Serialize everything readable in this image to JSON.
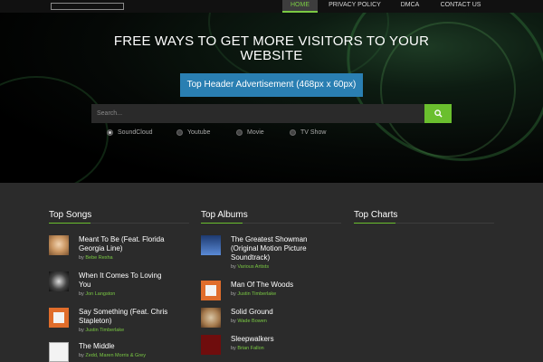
{
  "nav": {
    "items": [
      {
        "label": "HOME",
        "active": true
      },
      {
        "label": "PRIVACY POLICY",
        "active": false
      },
      {
        "label": "DMCA",
        "active": false
      },
      {
        "label": "CONTACT US",
        "active": false
      }
    ]
  },
  "hero": {
    "title_line1": "FREE WAYS TO GET MORE VISITORS TO YOUR",
    "title_line2": "WEBSITE",
    "ad_label": "Top Header Advertisement (468px x 60px)"
  },
  "search": {
    "placeholder": "Search...",
    "button_icon": "search-icon",
    "options": [
      {
        "label": "SoundCloud",
        "selected": true
      },
      {
        "label": "Youtube",
        "selected": false
      },
      {
        "label": "Movie",
        "selected": false
      },
      {
        "label": "TV Show",
        "selected": false
      }
    ]
  },
  "colors": {
    "accent": "#6abf2e",
    "ad": "#2a7fb2",
    "background": "#2b2b2b"
  },
  "top_songs": {
    "title": "Top Songs",
    "by": "by",
    "items": [
      {
        "line1": "Meant To Be (Feat. Florida",
        "line2": "Georgia Line)",
        "artist": "Bebe Rexha"
      },
      {
        "line1": "When It Comes To Loving",
        "line2": "You",
        "artist": "Jon Langston"
      },
      {
        "line1": "Say Something (Feat. Chris",
        "line2": "Stapleton)",
        "artist": "Justin Timberlake"
      },
      {
        "line1": "The Middle",
        "line2": "",
        "artist": "Zedd, Maren Morris & Grey"
      }
    ]
  },
  "top_albums": {
    "title": "Top Albums",
    "items": [
      {
        "line1": "The Greatest Showman",
        "line2": "(Original Motion Picture",
        "line3": "Soundtrack)",
        "artist": "Various Artists"
      },
      {
        "line1": "Man Of The Woods",
        "artist": "Justin Timberlake"
      },
      {
        "line1": "Solid Ground",
        "artist": "Wade Bowen"
      },
      {
        "line1": "Sleepwalkers",
        "artist": "Brian Fallon"
      }
    ]
  },
  "top_charts": {
    "title": "Top Charts"
  }
}
